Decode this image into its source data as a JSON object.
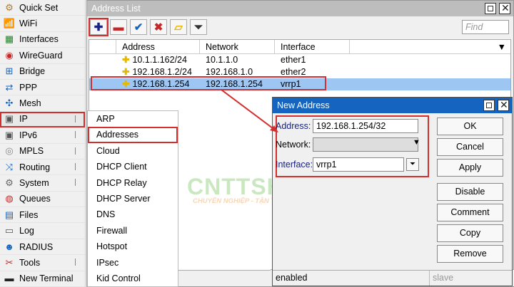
{
  "sidebar": {
    "items": [
      {
        "label": "Quick Set",
        "icon": "quick-set-icon",
        "glyph": "⚙",
        "color": "#b07d2b"
      },
      {
        "label": "WiFi",
        "icon": "wifi-icon",
        "glyph": "📶",
        "color": "#3a7a3a"
      },
      {
        "label": "Interfaces",
        "icon": "interfaces-icon",
        "glyph": "▦",
        "color": "#2e7d32"
      },
      {
        "label": "WireGuard",
        "icon": "wireguard-icon",
        "glyph": "◉",
        "color": "#c62828"
      },
      {
        "label": "Bridge",
        "icon": "bridge-icon",
        "glyph": "⊞",
        "color": "#1565c0"
      },
      {
        "label": "PPP",
        "icon": "ppp-icon",
        "glyph": "⇄",
        "color": "#1565c0"
      },
      {
        "label": "Mesh",
        "icon": "mesh-icon",
        "glyph": "✣",
        "color": "#1565c0"
      },
      {
        "label": "IP",
        "icon": "ip-icon",
        "glyph": "▣",
        "color": "#555"
      },
      {
        "label": "IPv6",
        "icon": "ipv6-icon",
        "glyph": "▣",
        "color": "#555"
      },
      {
        "label": "MPLS",
        "icon": "mpls-icon",
        "glyph": "◎",
        "color": "#888"
      },
      {
        "label": "Routing",
        "icon": "routing-icon",
        "glyph": "⤨",
        "color": "#1565c0"
      },
      {
        "label": "System",
        "icon": "system-icon",
        "glyph": "⚙",
        "color": "#666"
      },
      {
        "label": "Queues",
        "icon": "queues-icon",
        "glyph": "◍",
        "color": "#c62828"
      },
      {
        "label": "Files",
        "icon": "files-icon",
        "glyph": "▤",
        "color": "#1565c0"
      },
      {
        "label": "Log",
        "icon": "log-icon",
        "glyph": "▭",
        "color": "#555"
      },
      {
        "label": "RADIUS",
        "icon": "radius-icon",
        "glyph": "☻",
        "color": "#1565c0"
      },
      {
        "label": "Tools",
        "icon": "tools-icon",
        "glyph": "✂",
        "color": "#c62828"
      },
      {
        "label": "New Terminal",
        "icon": "terminal-icon",
        "glyph": "▬",
        "color": "#222"
      }
    ]
  },
  "submenu": {
    "items": [
      "ARP",
      "Addresses",
      "Cloud",
      "DHCP Client",
      "DHCP Relay",
      "DHCP Server",
      "DNS",
      "Firewall",
      "Hotspot",
      "IPsec",
      "Kid Control"
    ]
  },
  "address_list": {
    "title": "Address List",
    "find_placeholder": "Find",
    "columns": [
      "Address",
      "Network",
      "Interface"
    ],
    "rows": [
      {
        "address": "10.1.1.162/24",
        "network": "10.1.1.0",
        "interface": "ether1"
      },
      {
        "address": "192.168.1.2/24",
        "network": "192.168.1.0",
        "interface": "ether2"
      },
      {
        "address": "192.168.1.254",
        "network": "192.168.1.254",
        "interface": "vrrp1"
      }
    ]
  },
  "new_address": {
    "title": "New Address",
    "address_label": "Address:",
    "address_value": "192.168.1.254/32",
    "network_label": "Network:",
    "network_value": "",
    "interface_label": "Interface:",
    "interface_value": "vrrp1",
    "buttons": {
      "ok": "OK",
      "cancel": "Cancel",
      "apply": "Apply",
      "disable": "Disable",
      "comment": "Comment",
      "copy": "Copy",
      "remove": "Remove"
    },
    "status": {
      "left": "enabled",
      "right": "slave"
    }
  },
  "watermark": {
    "brand": "CNTTSHOP.vn",
    "tagline": "CHUYÊN NGHIỆP - TẬN THIỆN"
  },
  "colors": {
    "highlight": "#d32f2f",
    "selection": "#9ec6f3",
    "title_active": "#1565c0"
  }
}
